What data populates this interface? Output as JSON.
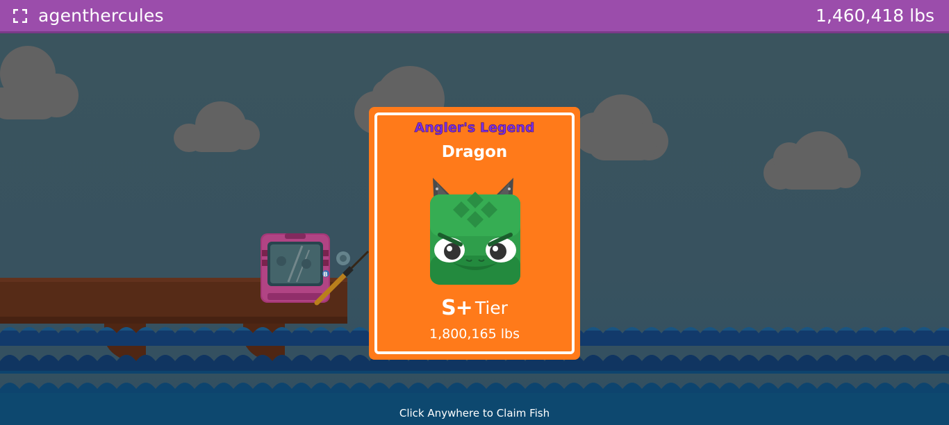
{
  "header": {
    "fullscreen_icon": "fullscreen-icon",
    "username": "agenthercules",
    "total_weight": "1,460,418 lbs"
  },
  "catch_card": {
    "title": "Angler's Legend",
    "fish_name": "Dragon",
    "fish_icon": "dragon-icon",
    "tier_badge": "S+",
    "tier_label": "Tier",
    "weight": "1,800,165 lbs"
  },
  "footer": {
    "hint": "Click Anywhere to Claim Fish"
  },
  "colors": {
    "header": "#9b4dab",
    "card": "#ff7a1a",
    "title": "#7e2fe0",
    "water": "#123f77"
  }
}
